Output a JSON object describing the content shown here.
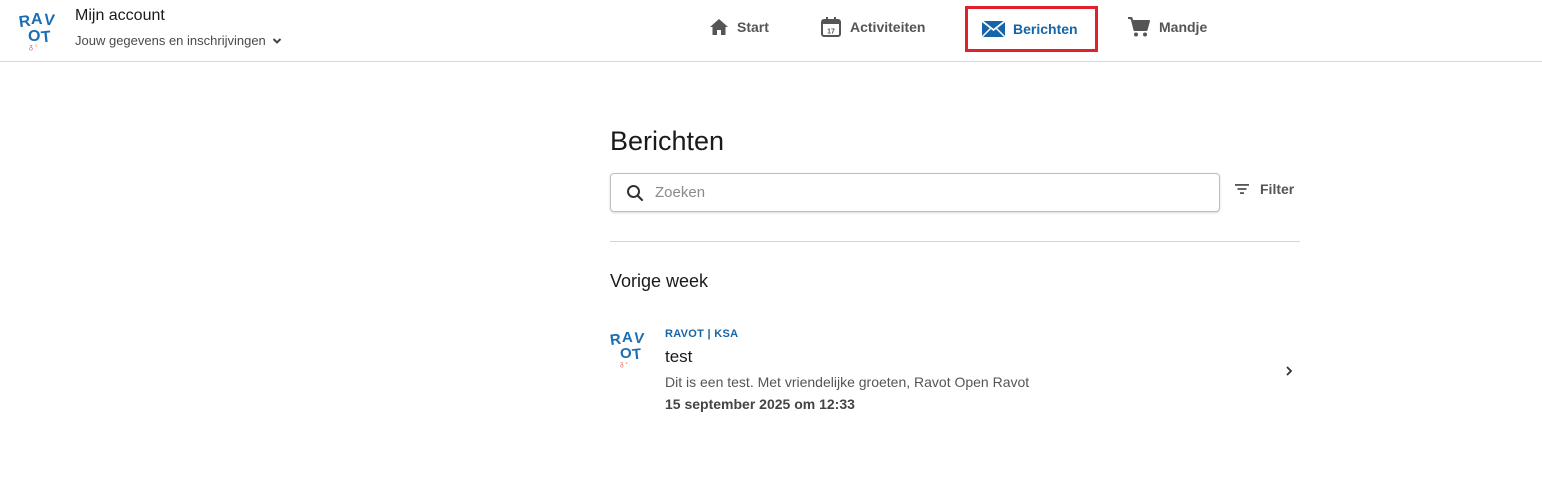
{
  "header": {
    "logo_text": "RAVOT",
    "account_title": "Mijn account",
    "account_subtitle": "Jouw gegevens en inschrijvingen"
  },
  "nav": {
    "items": [
      {
        "label": "Start",
        "icon": "home-icon"
      },
      {
        "label": "Activiteiten",
        "icon": "calendar-icon"
      },
      {
        "label": "Berichten",
        "icon": "envelope-icon",
        "active": true
      },
      {
        "label": "Mandje",
        "icon": "cart-icon"
      }
    ]
  },
  "main": {
    "title": "Berichten",
    "search": {
      "placeholder": "Zoeken",
      "value": ""
    },
    "filter_label": "Filter",
    "section_title": "Vorige week",
    "messages": [
      {
        "sender": "RAVOT | KSA",
        "subject": "test",
        "preview": "Dit is een test. Met vriendelijke groeten, Ravot Open Ravot",
        "date": "15 september 2025 om 12:33"
      }
    ]
  },
  "colors": {
    "accent": "#1565a8",
    "highlight_border": "#e0202a",
    "text_muted": "#555555"
  }
}
